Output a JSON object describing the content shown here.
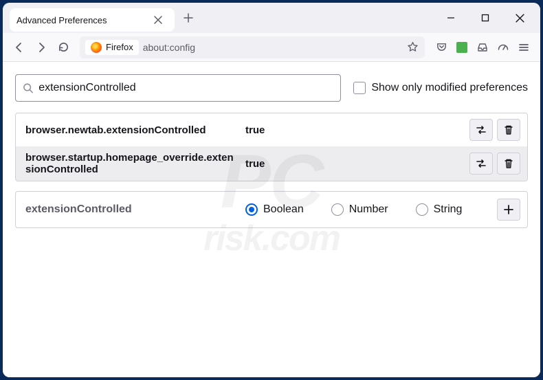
{
  "tab": {
    "title": "Advanced Preferences"
  },
  "urlbar": {
    "identity_label": "Firefox",
    "url": "about:config"
  },
  "search": {
    "value": "extensionControlled",
    "placeholder": ""
  },
  "modified_only": {
    "label": "Show only modified preferences",
    "checked": false
  },
  "prefs": [
    {
      "name": "browser.newtab.extensionControlled",
      "value": "true"
    },
    {
      "name": "browser.startup.homepage_override.extensionControlled",
      "value": "true"
    }
  ],
  "add_row": {
    "name": "extensionControlled",
    "types": [
      {
        "label": "Boolean",
        "selected": true
      },
      {
        "label": "Number",
        "selected": false
      },
      {
        "label": "String",
        "selected": false
      }
    ]
  },
  "watermark": {
    "line1": "PC",
    "line2": "risk.com"
  }
}
